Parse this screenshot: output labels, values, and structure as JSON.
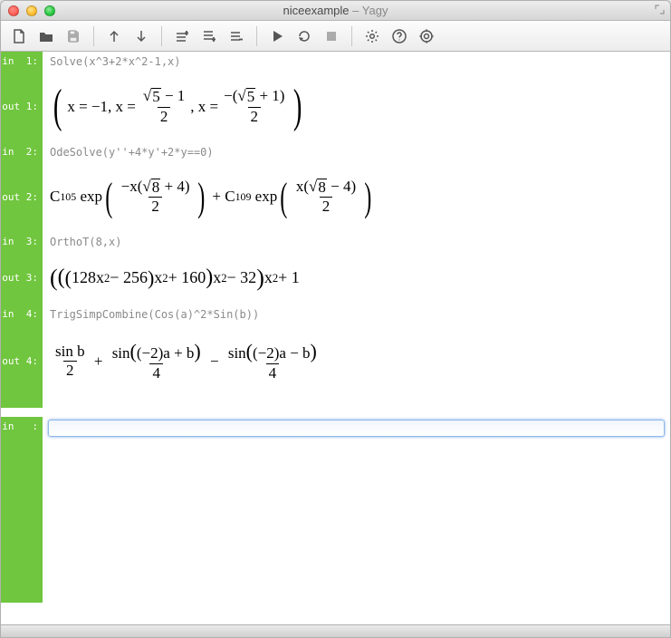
{
  "window": {
    "doc_name": "niceexample",
    "app_name": "Yagy"
  },
  "toolbar": {
    "new": "New",
    "open": "Open",
    "save": "Save",
    "up": "Move Up",
    "down": "Move Down",
    "insert_above": "Insert Above",
    "insert_below": "Insert Below",
    "remove": "Remove Cell",
    "run": "Run",
    "rerun": "Re-run",
    "stop": "Stop",
    "settings": "Settings",
    "help": "Help",
    "target": "Inspect"
  },
  "cells": [
    {
      "in_label": "in  1:",
      "out_label": "out 1:",
      "input": "Solve(x^3+2*x^2-1,x)",
      "output_text": "( x = -1, x = (√5 - 1)/2 , x = -(√5 + 1)/2 )",
      "output_data": {
        "type": "solution_list",
        "variable": "x",
        "solutions": [
          "-1",
          "(sqrt(5)-1)/2",
          "-(sqrt(5)+1)/2"
        ]
      }
    },
    {
      "in_label": "in  2:",
      "out_label": "out 2:",
      "input": "OdeSolve(y''+4*y'+2*y==0)",
      "output_text": "C105 exp( -x(√8 + 4)/2 ) + C109 exp( x(√8 - 4)/2 )",
      "output_data": {
        "type": "ode_solution",
        "terms": [
          {
            "coeff": "C105",
            "exponent": "-x*(sqrt(8)+4)/2"
          },
          {
            "coeff": "C109",
            "exponent": "x*(sqrt(8)-4)/2"
          }
        ]
      }
    },
    {
      "in_label": "in  3:",
      "out_label": "out 3:",
      "input": "OrthoT(8,x)",
      "output_text": "(((128x² - 256)x² + 160)x² - 32)x² + 1",
      "output_data": {
        "type": "polynomial",
        "nested": "(((128*x^2 - 256)*x^2 + 160)*x^2 - 32)*x^2 + 1"
      }
    },
    {
      "in_label": "in  4:",
      "out_label": "out 4:",
      "input": "TrigSimpCombine(Cos(a)^2*Sin(b))",
      "output_text": "sin b / 2 + sin((-2)a + b)/4 - sin((-2)a - b)/4",
      "output_data": {
        "type": "trig_sum",
        "terms": [
          {
            "num": "sin b",
            "den": "2",
            "sign": "+"
          },
          {
            "num": "sin((-2)a + b)",
            "den": "4",
            "sign": "+"
          },
          {
            "num": "sin((-2)a - b)",
            "den": "4",
            "sign": "-"
          }
        ]
      }
    }
  ],
  "active_prompt": {
    "label": "in   :",
    "value": ""
  },
  "colors": {
    "gutter": "#70c63e",
    "input_code": "#8a8a8a",
    "focus_ring": "#8fb8e8"
  }
}
